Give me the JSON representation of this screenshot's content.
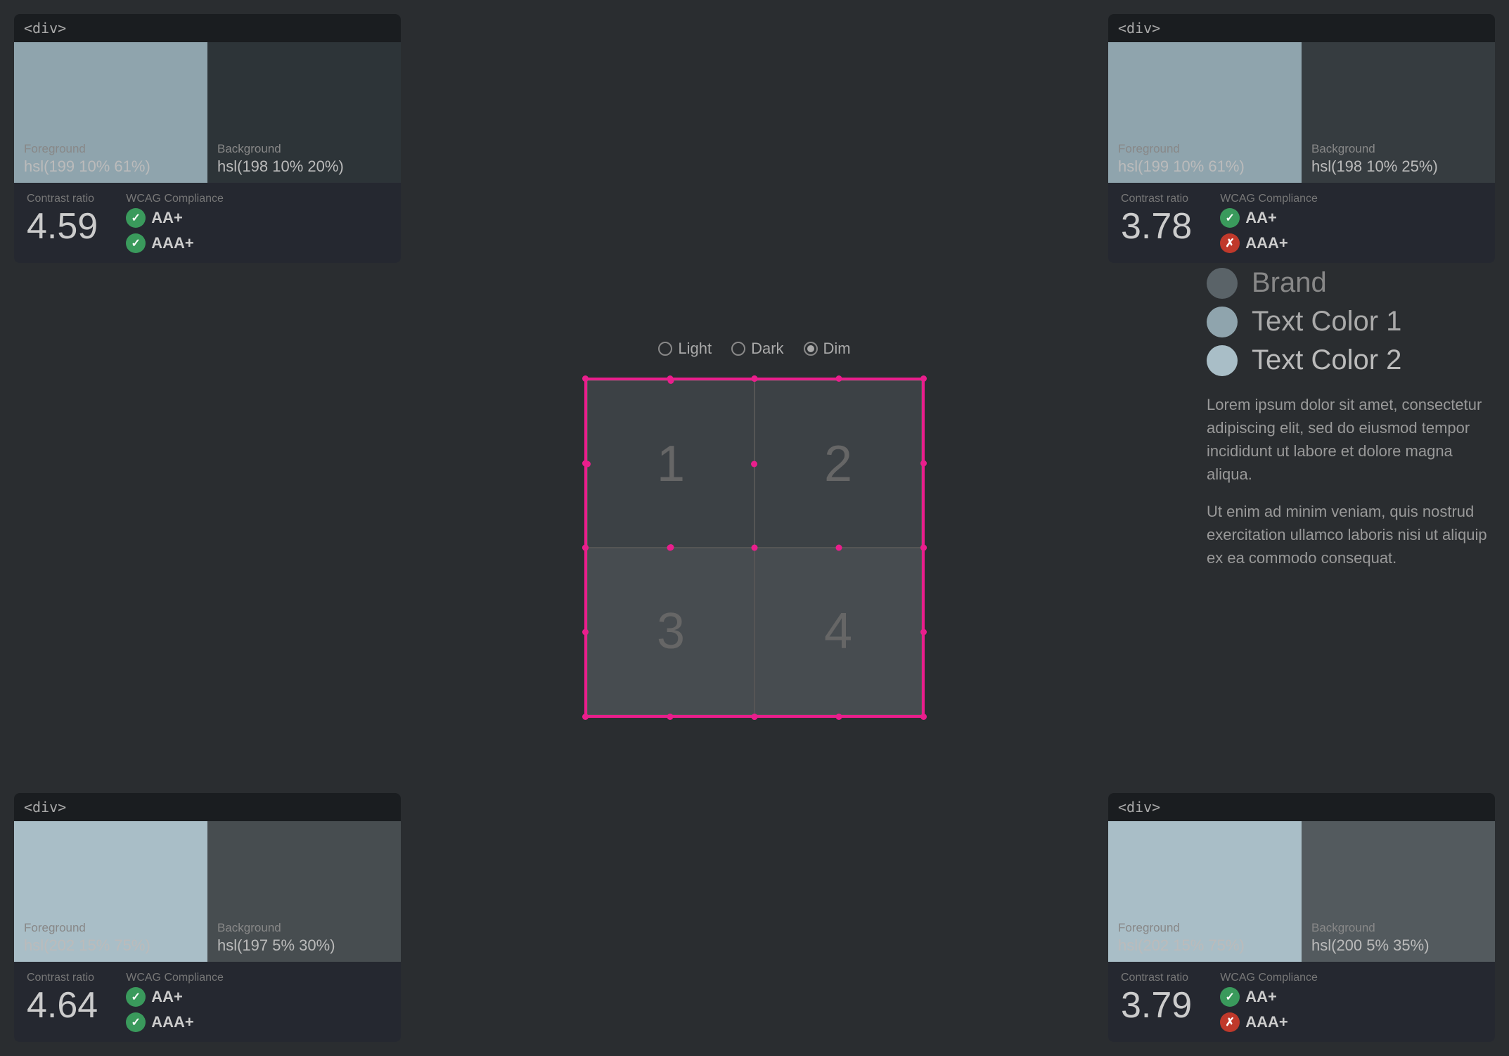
{
  "cards": {
    "top_left": {
      "title": "<div>",
      "foreground_label": "Foreground",
      "foreground_value": "hsl(199 10% 61%)",
      "background_label": "Background",
      "background_value": "hsl(198 10% 20%)",
      "foreground_color": "#8fa4ad",
      "background_color": "#2d3438",
      "contrast_label": "Contrast ratio",
      "contrast_value": "4.59",
      "wcag_label": "WCAG Compliance",
      "wcag_aa": "AA+",
      "wcag_aaa": "AAA+",
      "aa_pass": true,
      "aaa_pass": true
    },
    "top_right": {
      "title": "<div>",
      "foreground_label": "Foreground",
      "foreground_value": "hsl(199 10% 61%)",
      "background_label": "Background",
      "background_value": "hsl(198 10% 25%)",
      "foreground_color": "#8fa4ad",
      "background_color": "#363c40",
      "contrast_label": "Contrast ratio",
      "contrast_value": "3.78",
      "wcag_label": "WCAG Compliance",
      "wcag_aa": "AA+",
      "wcag_aaa": "AAA+",
      "aa_pass": true,
      "aaa_pass": false
    },
    "bottom_left": {
      "title": "<div>",
      "foreground_label": "Foreground",
      "foreground_value": "hsl(202 15% 75%)",
      "background_label": "Background",
      "background_value": "hsl(197 5% 30%)",
      "foreground_color": "#a9bec7",
      "background_color": "#474d50",
      "contrast_label": "Contrast ratio",
      "contrast_value": "4.64",
      "wcag_label": "WCAG Compliance",
      "wcag_aa": "AA+",
      "wcag_aaa": "AAA+",
      "aa_pass": true,
      "aaa_pass": true
    },
    "bottom_right": {
      "title": "<div>",
      "foreground_label": "Foreground",
      "foreground_value": "hsl(202 15% 75%)",
      "background_label": "Background",
      "background_value": "hsl(200 5% 35%)",
      "foreground_color": "#a9bec7",
      "background_color": "#535a5e",
      "contrast_label": "Contrast ratio",
      "contrast_value": "3.79",
      "wcag_label": "WCAG Compliance",
      "wcag_aa": "AA+",
      "wcag_aaa": "AAA+",
      "aa_pass": true,
      "aaa_pass": false
    }
  },
  "theme_selector": {
    "options": [
      "Light",
      "Dark",
      "Dim"
    ],
    "selected": "Dim"
  },
  "grid_cells": [
    "1",
    "2",
    "3",
    "4"
  ],
  "legend": {
    "items": [
      {
        "label": "Brand",
        "color": "#5a6368"
      },
      {
        "label": "Text Color 1",
        "color": "#8fa4ad"
      },
      {
        "label": "Text Color 2",
        "color": "#a9bec7"
      }
    ],
    "body_text_1": "Lorem ipsum dolor sit amet, consectetur adipiscing elit, sed do eiusmod tempor incididunt ut labore et dolore magna aliqua.",
    "body_text_2": "Ut enim ad minim veniam, quis nostrud exercitation ullamco laboris nisi ut aliquip ex ea commodo consequat."
  }
}
